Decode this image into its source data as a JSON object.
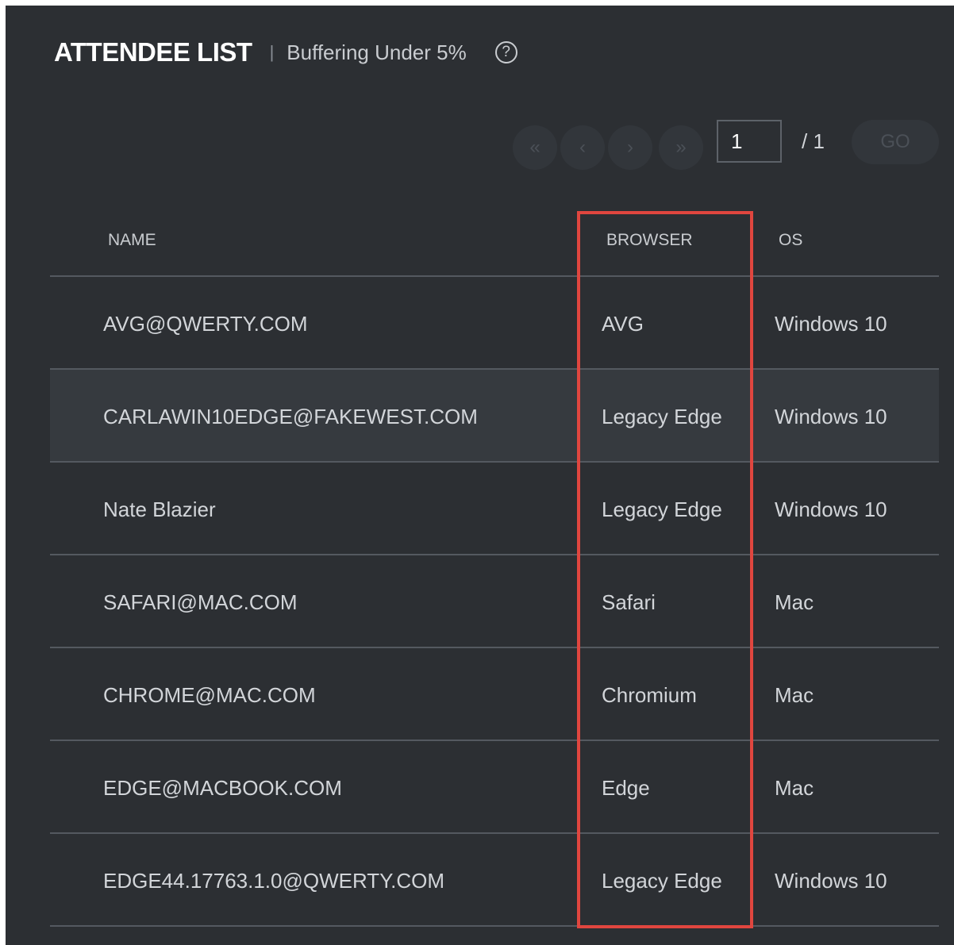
{
  "header": {
    "title": "ATTENDEE LIST",
    "divider": "|",
    "subtitle": "Buffering Under 5%",
    "help_icon": "?"
  },
  "pager": {
    "first_icon": "«",
    "prev_icon": "‹",
    "next_icon": "›",
    "last_icon": "»",
    "current_page": "1",
    "total": "/ 1",
    "go_label": "GO"
  },
  "table": {
    "columns": [
      "NAME",
      "BROWSER",
      "OS"
    ],
    "rows": [
      {
        "name": "AVG@QWERTY.COM",
        "browser": "AVG",
        "os": "Windows 10"
      },
      {
        "name": "CARLAWIN10EDGE@FAKEWEST.COM",
        "browser": "Legacy Edge",
        "os": "Windows 10"
      },
      {
        "name": "Nate Blazier",
        "browser": "Legacy Edge",
        "os": "Windows 10"
      },
      {
        "name": "SAFARI@MAC.COM",
        "browser": "Safari",
        "os": "Mac"
      },
      {
        "name": "CHROME@MAC.COM",
        "browser": "Chromium",
        "os": "Mac"
      },
      {
        "name": "EDGE@MACBOOK.COM",
        "browser": "Edge",
        "os": "Mac"
      },
      {
        "name": "EDGE44.17763.1.0@QWERTY.COM",
        "browser": "Legacy Edge",
        "os": "Windows 10"
      }
    ]
  },
  "colors": {
    "panel_bg": "#2c2f33",
    "row_highlight": "#363a3f",
    "annotation_red": "#e0463f"
  }
}
